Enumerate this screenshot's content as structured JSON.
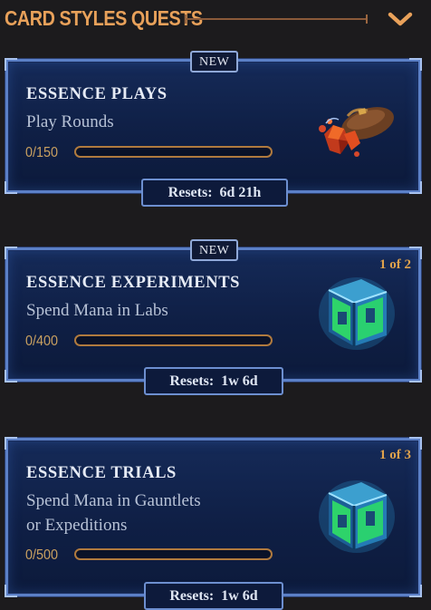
{
  "header": {
    "title": "CARD STYLES QUESTS",
    "collapse_icon": "chevron-down-icon"
  },
  "quests": [
    {
      "badge": "NEW",
      "title": "ESSENCE PLAYS",
      "description": "Play Rounds",
      "progress_text": "0/150",
      "progress_fraction": 0,
      "reset_label": "Resets:",
      "reset_value": "6d 21h",
      "reward_icon": "essence-crystal-pouch-icon"
    },
    {
      "badge": "NEW",
      "title": "ESSENCE EXPERIMENTS",
      "description": "Spend Mana in Labs",
      "progress_text": "0/400",
      "progress_fraction": 0,
      "count": "1 of 2",
      "reset_label": "Resets:",
      "reset_value": "1w 6d",
      "reward_icon": "essence-chest-icon"
    },
    {
      "title": "ESSENCE TRIALS",
      "description_line1": "Spend Mana in Gauntlets",
      "description_line2": "or Expeditions",
      "progress_text": "0/500",
      "progress_fraction": 0,
      "count": "1 of 3",
      "reset_label": "Resets:",
      "reset_value": "1w 6d",
      "reward_icon": "essence-chest-icon"
    }
  ],
  "colors": {
    "accent_orange": "#e8a15a",
    "card_border": "#5b80c7",
    "card_bg": "#0f1f45",
    "progress_border": "#b07a3e"
  }
}
